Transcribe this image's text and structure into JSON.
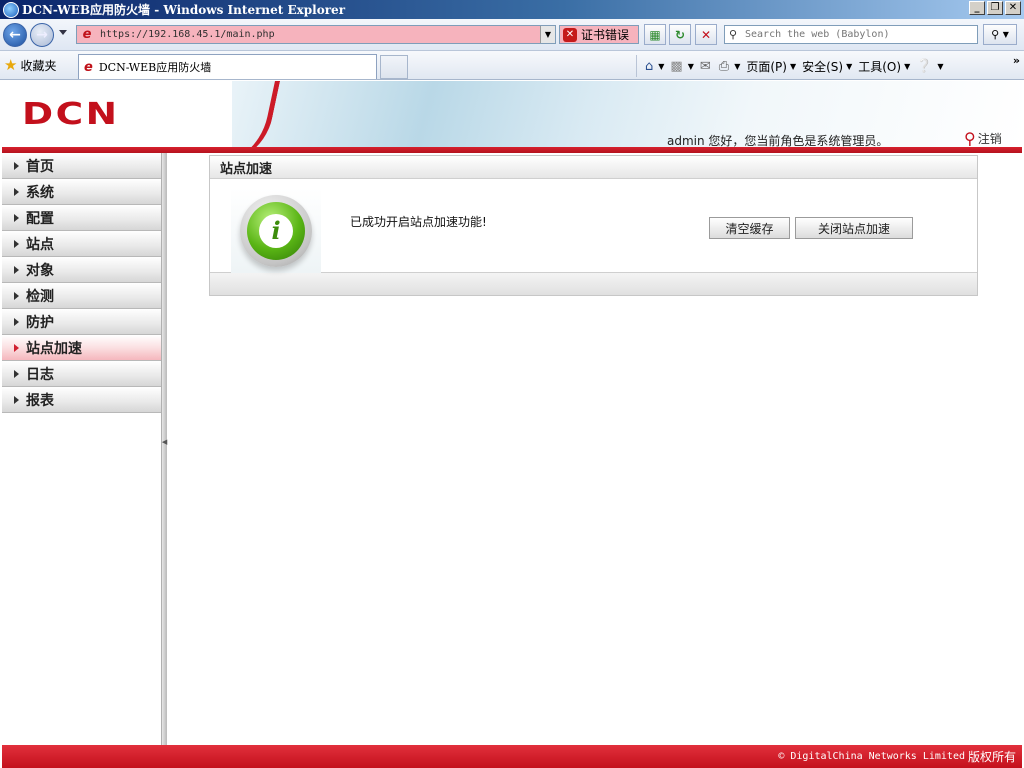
{
  "window": {
    "title": "DCN-WEB应用防火墙 - Windows Internet Explorer",
    "minimize": "_",
    "restore": "❐",
    "close": "✕"
  },
  "addressbar": {
    "url": "https://192.168.45.1/main.php",
    "cert_error": "证书错误",
    "search_placeholder": "Search the web (Babylon)"
  },
  "favbar": {
    "favorites": "收藏夹",
    "tab_title": "DCN-WEB应用防火墙",
    "cmd_page": "页面(P)",
    "cmd_safety": "安全(S)",
    "cmd_tools": "工具(O)"
  },
  "header": {
    "logo": "DCN",
    "welcome": "admin 您好，您当前角色是系统管理员。",
    "logout": "注销",
    "accent": "#c3101c"
  },
  "sidebar": {
    "items": [
      {
        "label": "首页"
      },
      {
        "label": "系统"
      },
      {
        "label": "配置"
      },
      {
        "label": "站点"
      },
      {
        "label": "对象"
      },
      {
        "label": "检测"
      },
      {
        "label": "防护"
      },
      {
        "label": "站点加速",
        "active": true
      },
      {
        "label": "日志"
      },
      {
        "label": "报表"
      }
    ]
  },
  "panel": {
    "title": "站点加速",
    "message": "已成功开启站点加速功能!",
    "clear_cache": "清空缓存",
    "disable_accel": "关闭站点加速"
  },
  "footer": {
    "copyright_prefix": "© DigitalChina Networks Limited",
    "copyright_suffix": "版权所有"
  }
}
